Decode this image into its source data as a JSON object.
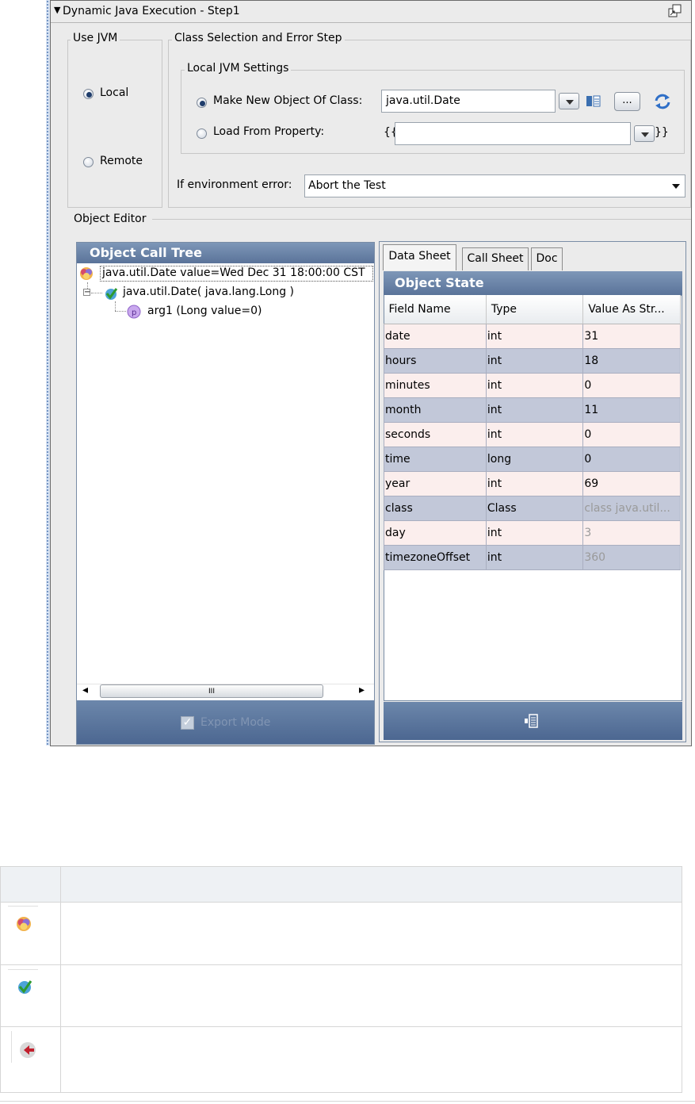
{
  "window": {
    "title": "Dynamic Java Execution - Step1",
    "collapse_glyph": "▼"
  },
  "use_jvm": {
    "legend": "Use JVM",
    "local_label": "Local",
    "remote_label": "Remote",
    "selected": "Local"
  },
  "class_selection": {
    "legend": "Class Selection and Error Step",
    "local_settings_legend": "Local JVM Settings",
    "make_new_label": "Make New Object Of Class:",
    "class_value": "java.util.Date",
    "browse_label": "...",
    "load_label": "Load From Property:",
    "open_braces": "{{",
    "close_braces": "}}",
    "property_value": "",
    "selected": "Make New Object Of Class:",
    "env_error_label": "If environment error:",
    "env_error_value": "Abort the Test"
  },
  "object_editor": {
    "legend": "Object Editor",
    "tree": {
      "header": "Object Call Tree",
      "nodes": [
        "java.util.Date value=Wed Dec 31 18:00:00 CST",
        "java.util.Date( java.lang.Long )",
        "arg1 (Long value=0)"
      ],
      "expander": "−",
      "scroll_left": "◂",
      "scroll_right": "▸",
      "scroll_thumb": "III",
      "export_label": "Export Mode",
      "export_checked": true
    },
    "tabs": [
      "Data Sheet",
      "Call Sheet",
      "Doc"
    ],
    "active_tab": "Data Sheet",
    "state": {
      "header": "Object State",
      "columns": [
        "Field Name",
        "Type",
        "Value As Str..."
      ],
      "rows": [
        [
          "date",
          "int",
          "31"
        ],
        [
          "hours",
          "int",
          "18"
        ],
        [
          "minutes",
          "int",
          "0"
        ],
        [
          "month",
          "int",
          "11"
        ],
        [
          "seconds",
          "int",
          "0"
        ],
        [
          "time",
          "long",
          "0"
        ],
        [
          "year",
          "int",
          "69"
        ],
        [
          "class",
          "Class",
          "class java.util..."
        ],
        [
          "day",
          "int",
          "3"
        ],
        [
          "timezoneOffset",
          "int",
          "360"
        ]
      ]
    }
  },
  "icons": {
    "float": "float-window-icon",
    "class_browser": "class-browser-icon",
    "refresh": "refresh-icon",
    "object": "object-node-icon",
    "constructor": "constructor-node-icon",
    "parameter": "parameter-node-icon",
    "properties": "properties-icon",
    "method": "method-node-icon"
  },
  "colors": {
    "panel_header": "#6a83a8",
    "row_odd": "#fbeeed",
    "row_even": "#c2c8d9"
  }
}
